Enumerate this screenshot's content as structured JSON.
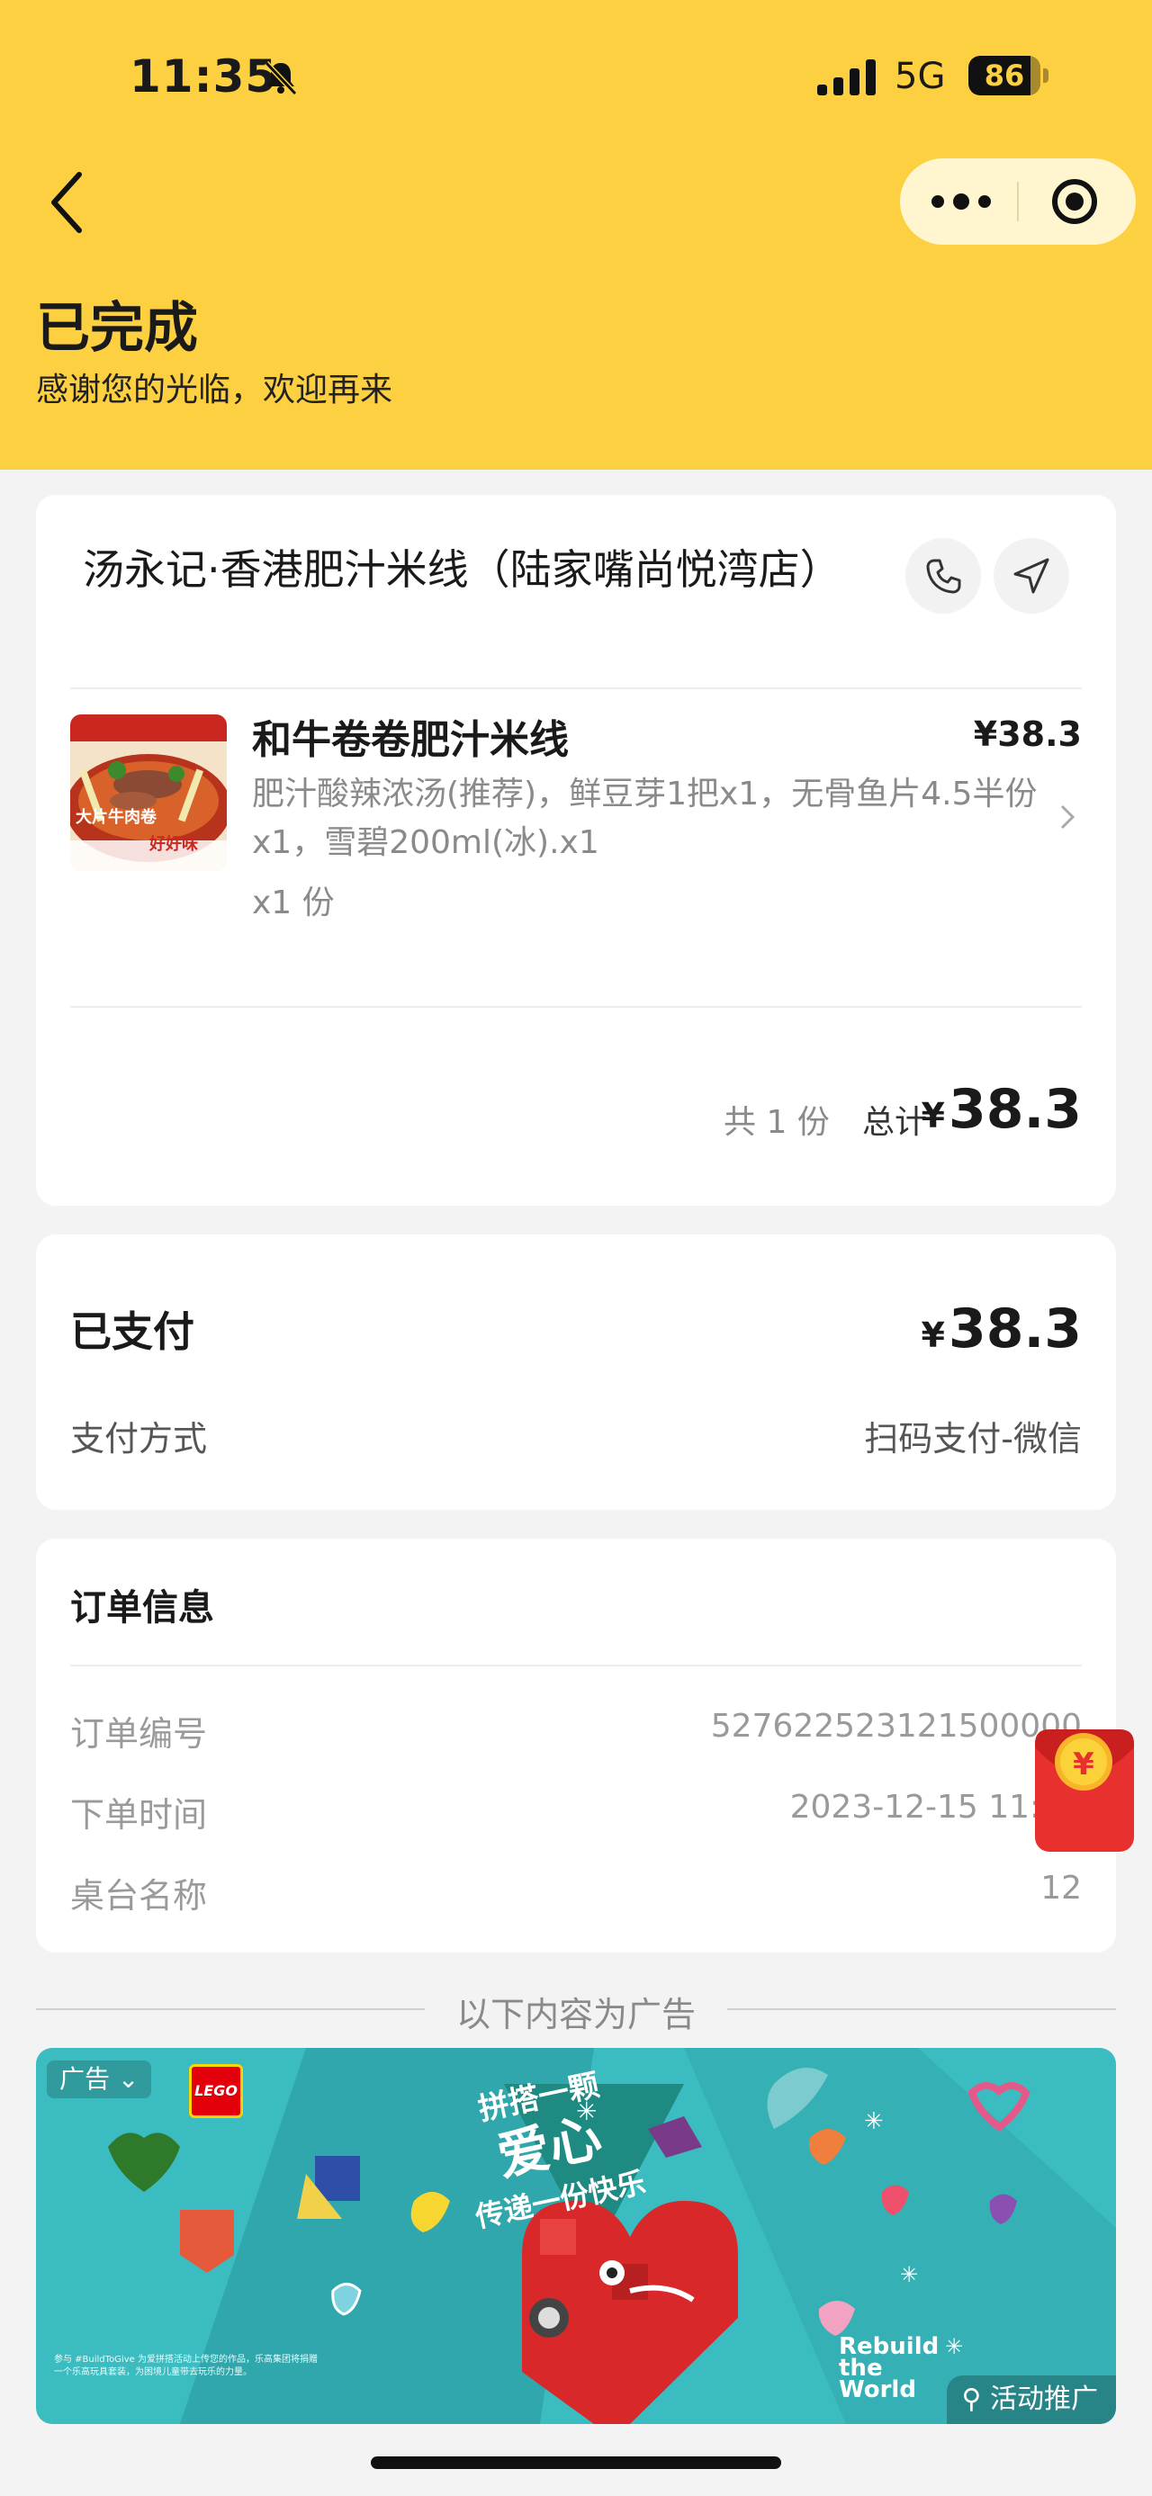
{
  "status_bar": {
    "time": "11:35",
    "network": "5G",
    "battery_level": 86,
    "battery_label": "86"
  },
  "header": {
    "title": "已完成",
    "subtitle": "感谢您的光临，欢迎再来"
  },
  "store": {
    "name": "汤永记·香港肥汁米线（陆家嘴尚悦湾店）",
    "item": {
      "name": "和牛卷卷肥汁米线",
      "price": "¥38.3",
      "options": "肥汁酸辣浓汤(推荐)，鲜豆芽1把x1，无骨鱼片4.5半份x1，雪碧200ml(冰).x1",
      "quantity": "x1 份",
      "image_text_1": "大片牛肉卷",
      "image_text_2": "好好味"
    },
    "count": "共 1 份",
    "total_label": "总计",
    "total_currency": "¥",
    "total_value": "38.3"
  },
  "payment": {
    "paid_label": "已支付",
    "paid_currency": "¥",
    "paid_value": "38.3",
    "method_label": "支付方式",
    "method_value": "扫码支付-微信"
  },
  "order_info": {
    "title": "订单信息",
    "rows": [
      {
        "label": "订单编号",
        "value": "527622523121500000"
      },
      {
        "label": "下单时间",
        "value": "2023-12-15 11:34"
      },
      {
        "label": "桌台名称",
        "value": "12"
      }
    ]
  },
  "ad": {
    "divider_text": "以下内容为广告",
    "tag": "广告",
    "brand": "LEGO",
    "headline_1": "拼搭一颗",
    "headline_2": "爱心",
    "headline_3": "传递一份快乐",
    "slogan": "Rebuild the World",
    "fineprint": "参与 #BuildToGive 为爱拼搭活动上传您的作品，乐高集团将捐赠一个乐高玩具套装，为困境儿童带去玩乐的力量。",
    "promo_label": "活动推广"
  },
  "colors": {
    "header_bg": "#fdd042",
    "ad_bg": "#3bbcc0",
    "red_packet": "#e8302e"
  }
}
